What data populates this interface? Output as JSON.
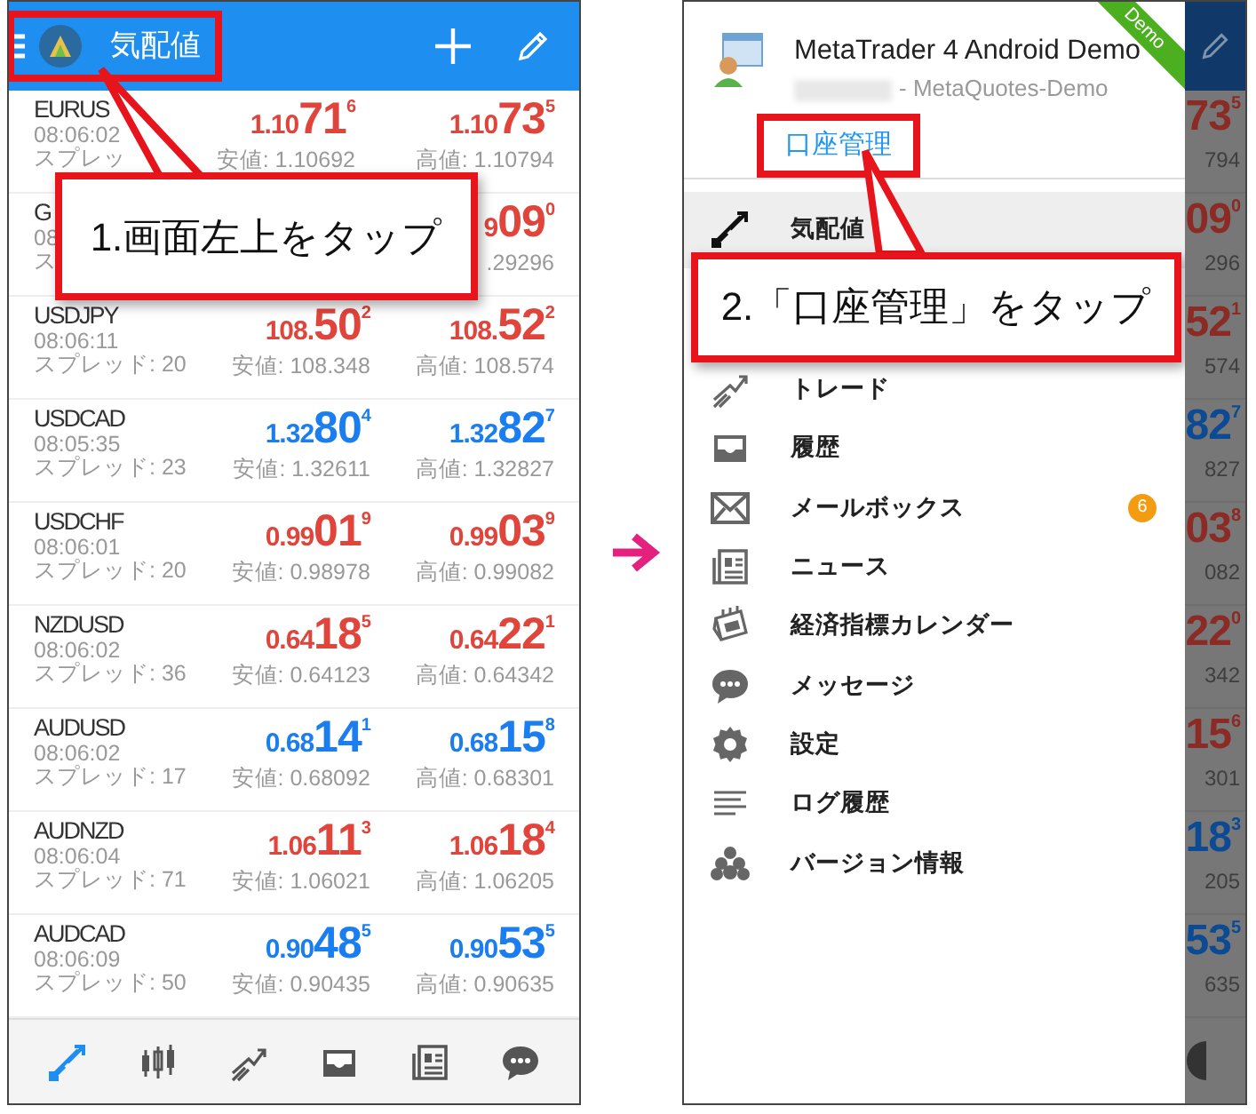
{
  "screen_1": {
    "header": {
      "title": "気配値"
    },
    "quotes": [
      {
        "symbol": "EURUS",
        "time": "08:06:02",
        "spread": "スプレッ",
        "color": "#e0443a",
        "bid": {
          "pre": "1.10",
          "big": "71",
          "sup": "6"
        },
        "ask": {
          "pre": "1.10",
          "big": "73",
          "sup": "5"
        },
        "low": "安値: 1.10692",
        "high": "高値: 1.10794"
      },
      {
        "symbol": "G",
        "time": "08",
        "spread": "ス",
        "color": "#e0443a",
        "ask": {
          "pre": "9",
          "big": "09",
          "sup": "0"
        },
        "high": ".29296"
      },
      {
        "symbol": "USDJPY",
        "time": "08:06:11",
        "spread": "スプレッド: 20",
        "color": "#e0443a",
        "bid": {
          "pre": "108.",
          "big": "50",
          "sup": "2"
        },
        "ask": {
          "pre": "108.",
          "big": "52",
          "sup": "2"
        },
        "low": "安値: 108.348",
        "high": "高値: 108.574"
      },
      {
        "symbol": "USDCAD",
        "time": "08:05:35",
        "spread": "スプレッド: 23",
        "color": "#1a7ef0",
        "bid": {
          "pre": "1.32",
          "big": "80",
          "sup": "4"
        },
        "ask": {
          "pre": "1.32",
          "big": "82",
          "sup": "7"
        },
        "low": "安値: 1.32611",
        "high": "高値: 1.32827"
      },
      {
        "symbol": "USDCHF",
        "time": "08:06:01",
        "spread": "スプレッド: 20",
        "color": "#e0443a",
        "bid": {
          "pre": "0.99",
          "big": "01",
          "sup": "9"
        },
        "ask": {
          "pre": "0.99",
          "big": "03",
          "sup": "9"
        },
        "low": "安値: 0.98978",
        "high": "高値: 0.99082"
      },
      {
        "symbol": "NZDUSD",
        "time": "08:06:02",
        "spread": "スプレッド: 36",
        "color": "#e0443a",
        "bid": {
          "pre": "0.64",
          "big": "18",
          "sup": "5"
        },
        "ask": {
          "pre": "0.64",
          "big": "22",
          "sup": "1"
        },
        "low": "安値: 0.64123",
        "high": "高値: 0.64342"
      },
      {
        "symbol": "AUDUSD",
        "time": "08:06:02",
        "spread": "スプレッド: 17",
        "color": "#1a7ef0",
        "bid": {
          "pre": "0.68",
          "big": "14",
          "sup": "1"
        },
        "ask": {
          "pre": "0.68",
          "big": "15",
          "sup": "8"
        },
        "low": "安値: 0.68092",
        "high": "高値: 0.68301"
      },
      {
        "symbol": "AUDNZD",
        "time": "08:06:04",
        "spread": "スプレッド: 71",
        "color": "#e0443a",
        "bid": {
          "pre": "1.06",
          "big": "11",
          "sup": "3"
        },
        "ask": {
          "pre": "1.06",
          "big": "18",
          "sup": "4"
        },
        "low": "安値: 1.06021",
        "high": "高値: 1.06205"
      },
      {
        "symbol": "AUDCAD",
        "time": "08:06:09",
        "spread": "スプレッド: 50",
        "color": "#1a7ef0",
        "bid": {
          "pre": "0.90",
          "big": "48",
          "sup": "5"
        },
        "ask": {
          "pre": "0.90",
          "big": "53",
          "sup": "5"
        },
        "low": "安値: 0.90435",
        "high": "高値: 0.90635"
      }
    ],
    "nav": [
      {
        "kind": "quotes",
        "selected": true
      },
      {
        "kind": "chart",
        "selected": false
      },
      {
        "kind": "trade",
        "selected": false
      },
      {
        "kind": "history",
        "selected": false
      },
      {
        "kind": "news",
        "selected": false
      },
      {
        "kind": "messages",
        "selected": false
      }
    ],
    "callout": {
      "text": "1.画面左上をタップ"
    }
  },
  "screen_2": {
    "account": {
      "name": "MetaTrader 4 Android Demo",
      "server": "- MetaQuotes-Demo",
      "link": "口座管理",
      "ribbon": "Demo"
    },
    "menu": [
      {
        "kind": "quotes",
        "label": "気配値",
        "selected": true
      },
      {
        "kind": "callout",
        "text": "2.「口座管理」をタップ"
      },
      {
        "kind": "trade",
        "label": "トレード",
        "selected": false
      },
      {
        "kind": "history",
        "label": "履歴",
        "selected": false
      },
      {
        "kind": "mailbox",
        "label": "メールボックス",
        "selected": false,
        "badge": "6"
      },
      {
        "kind": "news",
        "label": "ニュース",
        "selected": false
      },
      {
        "kind": "calendar",
        "label": "経済指標カレンダー",
        "selected": false
      },
      {
        "kind": "messages",
        "label": "メッセージ",
        "selected": false
      },
      {
        "kind": "settings",
        "label": "設定",
        "selected": false
      },
      {
        "kind": "journal",
        "label": "ログ履歴",
        "selected": false
      },
      {
        "kind": "about",
        "label": "バージョン情報",
        "selected": false
      }
    ],
    "background_quotes": [
      {
        "big": "73",
        "sup": "5",
        "sub": "794",
        "color": "#8c2a25"
      },
      {
        "big": "09",
        "sup": "0",
        "sub": "296",
        "color": "#8c2a25"
      },
      {
        "big": "52",
        "sup": "1",
        "sub": "574",
        "color": "#8c2a25"
      },
      {
        "big": "82",
        "sup": "7",
        "sub": "827",
        "color": "#0d4a94"
      },
      {
        "big": "03",
        "sup": "8",
        "sub": "082",
        "color": "#8c2a25"
      },
      {
        "big": "22",
        "sup": "0",
        "sub": "342",
        "color": "#8c2a25"
      },
      {
        "big": "15",
        "sup": "6",
        "sub": "301",
        "color": "#8c2a25"
      },
      {
        "big": "18",
        "sup": "3",
        "sub": "205",
        "color": "#0d4a94"
      },
      {
        "big": "53",
        "sup": "5",
        "sub": "635",
        "color": "#0d4a94"
      }
    ]
  }
}
